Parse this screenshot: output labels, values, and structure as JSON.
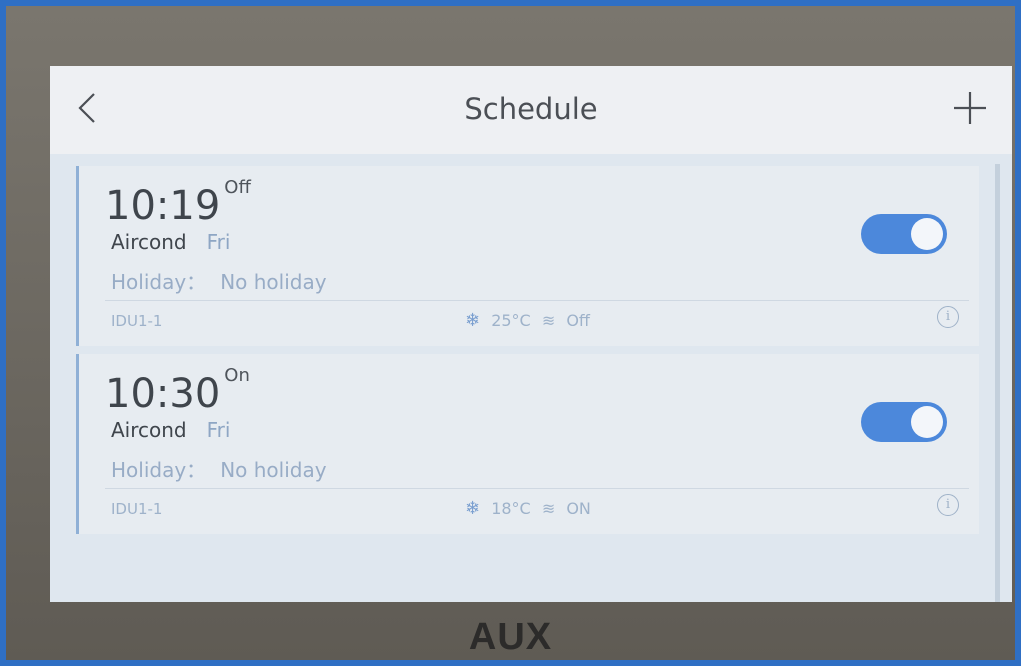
{
  "header": {
    "title": "Schedule"
  },
  "schedules": [
    {
      "time": "10:19",
      "mode": "Off",
      "device_type": "Aircond",
      "day": "Fri",
      "holiday_label": "Holiday：",
      "holiday_value": "No holiday",
      "device_id": "IDU1-1",
      "temperature": "25°C",
      "fan": "Off",
      "enabled": true
    },
    {
      "time": "10:30",
      "mode": "On",
      "device_type": "Aircond",
      "day": "Fri",
      "holiday_label": "Holiday：",
      "holiday_value": "No holiday",
      "device_id": "IDU1-1",
      "temperature": "18°C",
      "fan": "ON",
      "enabled": true
    }
  ],
  "brand": "AUX",
  "colors": {
    "accent": "#4c88db",
    "frame": "#2f6fc4"
  },
  "icons": {
    "back": "chevron-left-icon",
    "add": "plus-icon",
    "mode": "snowflake-icon",
    "fan": "fan-speed-icon",
    "info": "info-icon"
  }
}
